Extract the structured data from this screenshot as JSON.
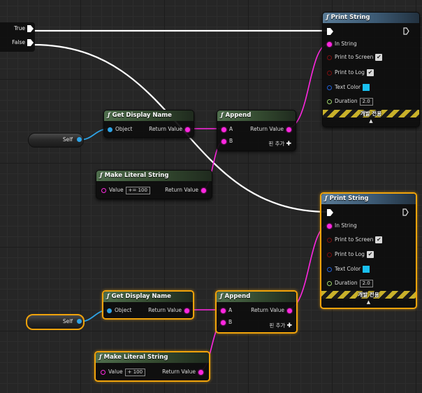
{
  "branch": {
    "true_label": "True",
    "false_label": "False"
  },
  "nodes": {
    "print_string_1": {
      "title": "Print String",
      "in_string": "In String",
      "print_to_screen": "Print to Screen",
      "print_to_log": "Print to Log",
      "text_color": "Text Color",
      "duration": "Duration",
      "duration_value": "2.0",
      "dev_only": "개발 전용",
      "print_to_screen_checked": true,
      "print_to_log_checked": true,
      "text_color_hex": "#19c0f0"
    },
    "print_string_2": {
      "title": "Print String",
      "in_string": "In String",
      "print_to_screen": "Print to Screen",
      "print_to_log": "Print to Log",
      "text_color": "Text Color",
      "duration": "Duration",
      "duration_value": "2.0",
      "dev_only": "개발 전용",
      "print_to_screen_checked": true,
      "print_to_log_checked": true,
      "text_color_hex": "#19c0f0"
    },
    "get_display_name_1": {
      "title": "Get Display Name",
      "object": "Object",
      "return_value": "Return Value"
    },
    "get_display_name_2": {
      "title": "Get Display Name",
      "object": "Object",
      "return_value": "Return Value"
    },
    "append_1": {
      "title": "Append",
      "a": "A",
      "b": "B",
      "return_value": "Return Value",
      "add_pin": "핀 추가"
    },
    "append_2": {
      "title": "Append",
      "a": "A",
      "b": "B",
      "return_value": "Return Value",
      "add_pin": "핀 추가"
    },
    "make_literal_1": {
      "title": "Make Literal String",
      "value_label": "Value",
      "value": "+= 100",
      "return_value": "Return Value"
    },
    "make_literal_2": {
      "title": "Make Literal String",
      "value_label": "Value",
      "value": "+ 100",
      "return_value": "Return Value"
    },
    "self_1": {
      "label": "Self"
    },
    "self_2": {
      "label": "Self"
    }
  },
  "colors": {
    "exec_wire": "#ffffff",
    "string_wire": "#ff27e0",
    "object_wire": "#2ea3e6",
    "selection": "#f0a30b",
    "function_header": "#4f6e4d",
    "print_header": "#5a7b96"
  },
  "icons": [
    "function-icon",
    "exec-pin-icon",
    "data-pin-icon",
    "checkbox-icon",
    "add-pin-icon",
    "collapse-arrow-icon"
  ]
}
